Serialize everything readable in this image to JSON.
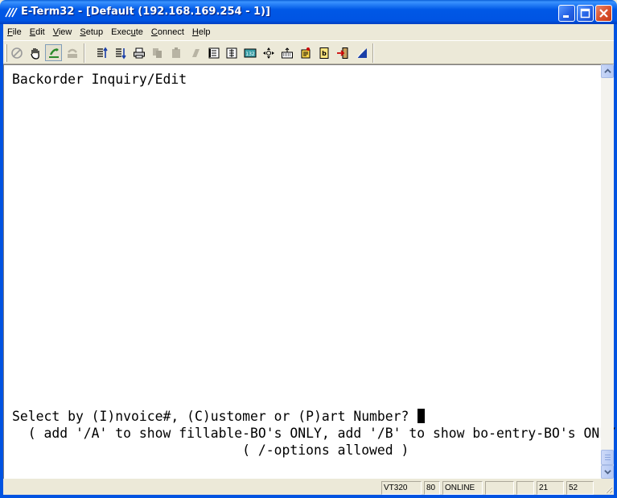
{
  "window": {
    "title": "E-Term32 - [Default (192.168.169.254 - 1)]"
  },
  "menu": [
    {
      "first": "F",
      "rest": "ile"
    },
    {
      "first": "E",
      "rest": "dit"
    },
    {
      "first": "V",
      "rest": "iew"
    },
    {
      "first": "S",
      "rest": "etup"
    },
    {
      "pre": "Exec",
      "first": "u",
      "rest": "te"
    },
    {
      "first": "C",
      "rest": "onnect"
    },
    {
      "first": "H",
      "rest": "elp"
    }
  ],
  "terminal": {
    "heading": "Backorder Inquiry/Edit",
    "prompt": "Select by (I)nvoice#, (C)ustomer or (P)art Number? ",
    "hint1": "  ( add '/A' to show fillable-BO's ONLY, add '/B' to show bo-entry-BO's ONLY )",
    "hint2": "                             ( /-options allowed )"
  },
  "status": {
    "emulation": "VT320",
    "columns": "80",
    "state": "ONLINE",
    "row": "21",
    "col": "52"
  },
  "colors": {
    "titlebar": "#0054e3",
    "chrome": "#ece9d8",
    "terminal_bg": "#ffffff",
    "terminal_fg": "#000000"
  }
}
